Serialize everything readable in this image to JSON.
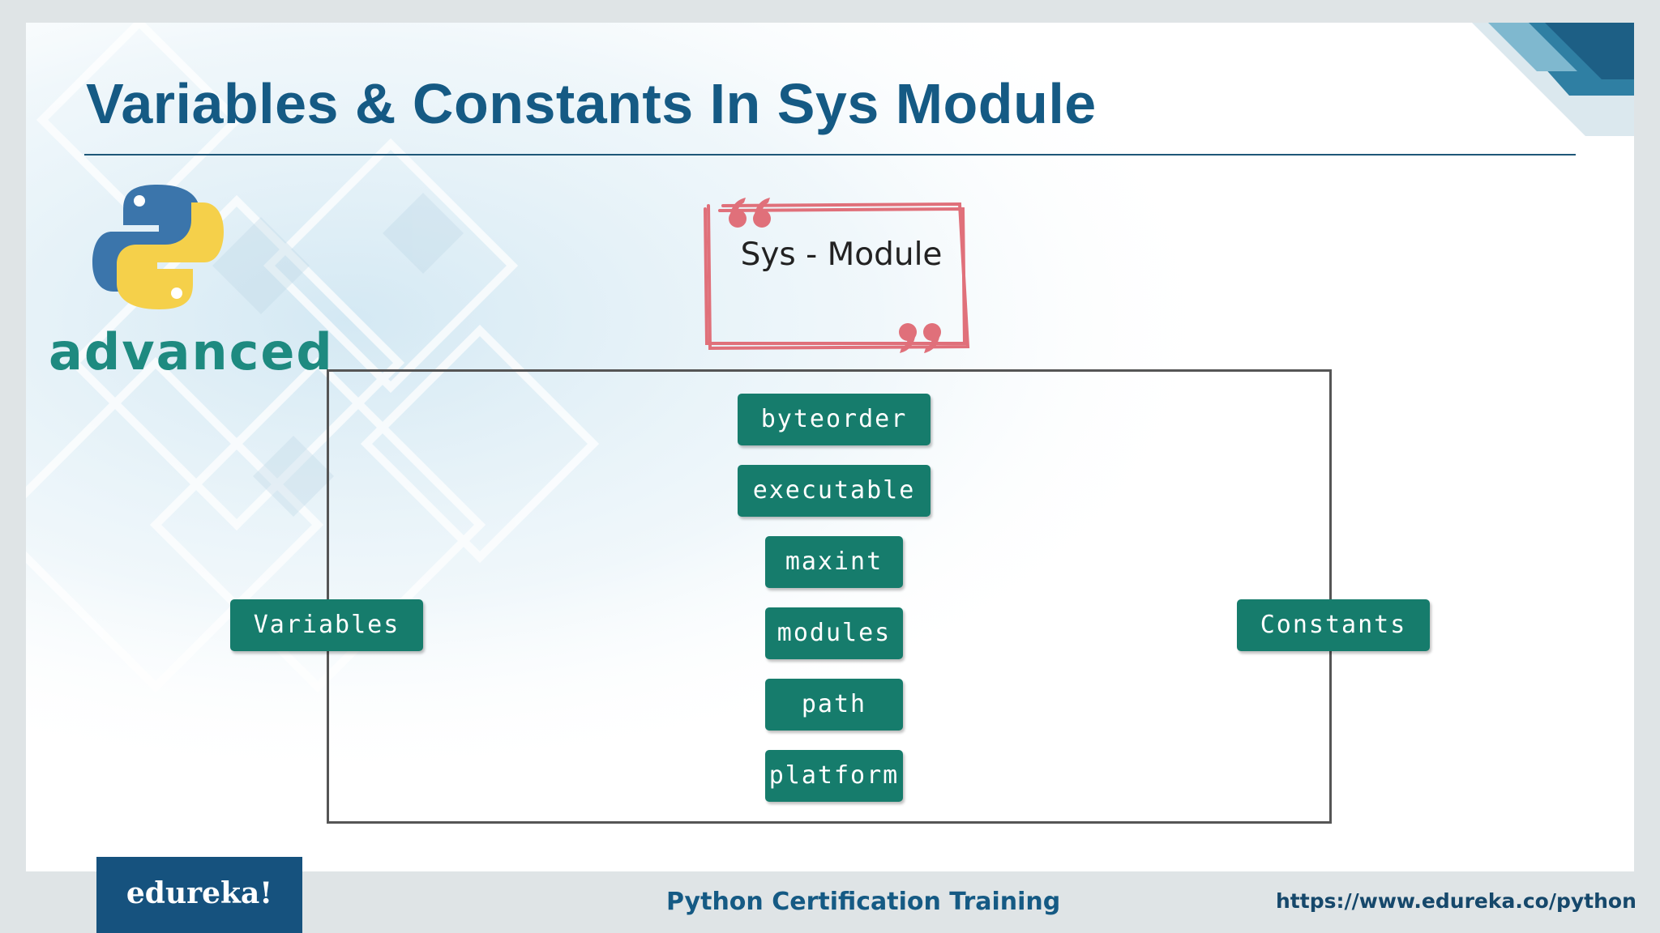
{
  "slide": {
    "title": "Variables & Constants In Sys Module",
    "brand_word": "advanced",
    "quote_label": "Sys - Module"
  },
  "diagram": {
    "left_node": "Variables",
    "right_node": "Constants",
    "items": [
      "byteorder",
      "executable",
      "maxint",
      "modules",
      "path",
      "platform"
    ]
  },
  "footer": {
    "logo_text": "edureka!",
    "course": "Python Certification Training",
    "url": "https://www.edureka.co/python"
  },
  "colors": {
    "title": "#155a84",
    "pill": "#167c6c",
    "quote_border": "#e0707a",
    "footer_logo_bg": "#16527e"
  },
  "icons": {
    "logo": "python-logo-icon",
    "quote_open": "open-quote-icon",
    "quote_close": "close-quote-icon"
  }
}
